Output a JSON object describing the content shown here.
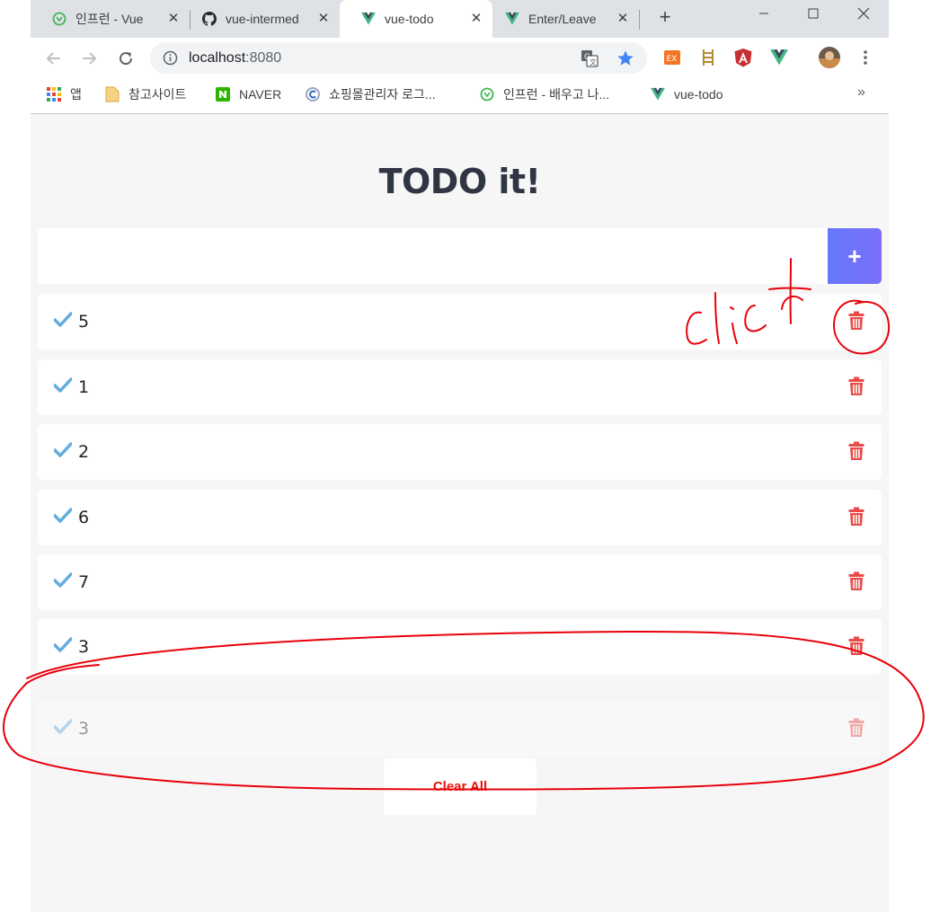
{
  "browser": {
    "tabs": [
      {
        "title": "인프런 - Vue",
        "icon": "inflearn-icon"
      },
      {
        "title": "vue-intermed",
        "icon": "github-icon"
      },
      {
        "title": "vue-todo",
        "icon": "vue-icon",
        "active": true
      },
      {
        "title": "Enter/Leave",
        "icon": "vue-icon"
      }
    ],
    "new_tab": "+",
    "url_host": "localhost",
    "url_port": ":8080",
    "bookmarks": [
      {
        "label": "앱",
        "icon": "apps-grid-icon"
      },
      {
        "label": "참고사이트",
        "icon": "folder-icon"
      },
      {
        "label": "NAVER",
        "icon": "naver-icon"
      },
      {
        "label": "쇼핑몰관리자 로그...",
        "icon": "cafe24-icon"
      },
      {
        "label": "인프런 - 배우고 나...",
        "icon": "inflearn-icon"
      },
      {
        "label": "vue-todo",
        "icon": "vue-icon"
      }
    ],
    "bookmarks_more": "»"
  },
  "app": {
    "title": "TODO it!",
    "input_value": "",
    "add_label": "+",
    "todos": [
      {
        "text": "5"
      },
      {
        "text": "1"
      },
      {
        "text": "2"
      },
      {
        "text": "6"
      },
      {
        "text": "7"
      },
      {
        "text": "3"
      }
    ],
    "leaving_todo": {
      "text": "3"
    },
    "clear_all_label": "Clear All"
  },
  "annotation": {
    "handwritten": "click",
    "color": "#e8000b"
  },
  "colors": {
    "check": "#62acde",
    "trash": "#e84a48",
    "add_button": "#6f74fa",
    "clear_all_text": "#e8140e"
  }
}
